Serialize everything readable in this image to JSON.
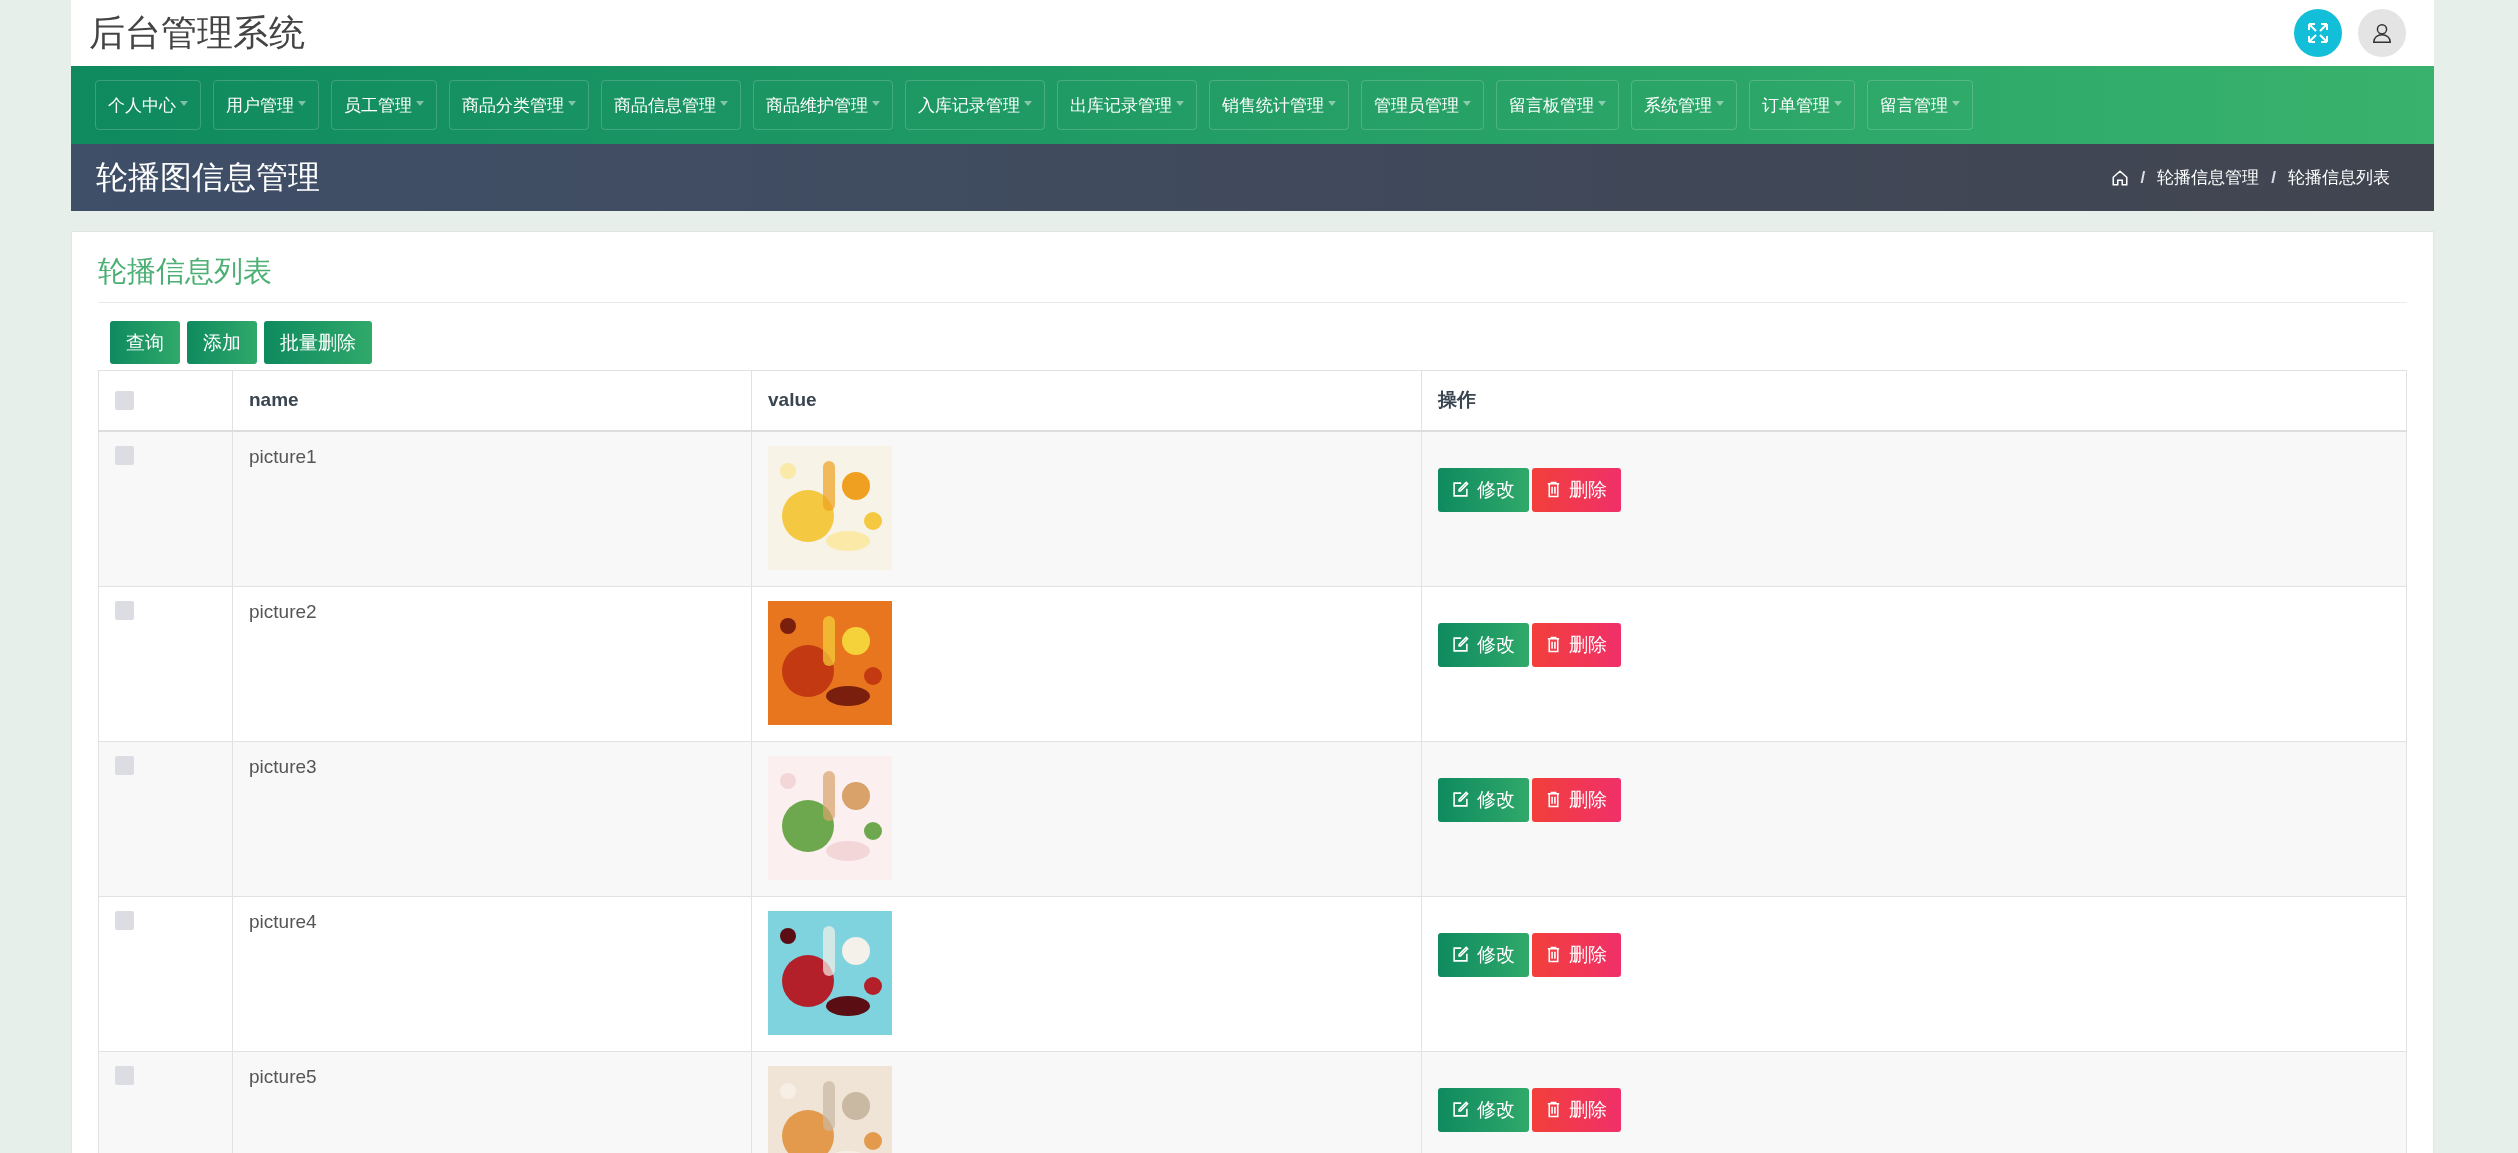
{
  "header": {
    "title": "后台管理系统"
  },
  "nav": [
    "个人中心",
    "用户管理",
    "员工管理",
    "商品分类管理",
    "商品信息管理",
    "商品维护管理",
    "入库记录管理",
    "出库记录管理",
    "销售统计管理",
    "管理员管理",
    "留言板管理",
    "系统管理",
    "订单管理",
    "留言管理"
  ],
  "page_title": "轮播图信息管理",
  "breadcrumb": [
    {
      "kind": "separator",
      "text": "/"
    },
    {
      "kind": "link",
      "text": "轮播信息管理"
    },
    {
      "kind": "separator",
      "text": "/"
    },
    {
      "kind": "link",
      "text": "轮播信息列表"
    }
  ],
  "card_title": "轮播信息列表",
  "toolbar": [
    "查询",
    "添加",
    "批量删除"
  ],
  "table": {
    "header_checked": false,
    "columns": [
      "name",
      "value",
      "操作"
    ],
    "rows": [
      {
        "name": "picture1",
        "checked": false,
        "actions": [
          "修改",
          "删除"
        ]
      },
      {
        "name": "picture2",
        "checked": false,
        "actions": [
          "修改",
          "删除"
        ]
      },
      {
        "name": "picture3",
        "checked": false,
        "actions": [
          "修改",
          "删除"
        ]
      },
      {
        "name": "picture4",
        "checked": false,
        "actions": [
          "修改",
          "删除"
        ]
      },
      {
        "name": "picture5",
        "checked": false,
        "actions": [
          "修改",
          "删除"
        ]
      }
    ]
  }
}
